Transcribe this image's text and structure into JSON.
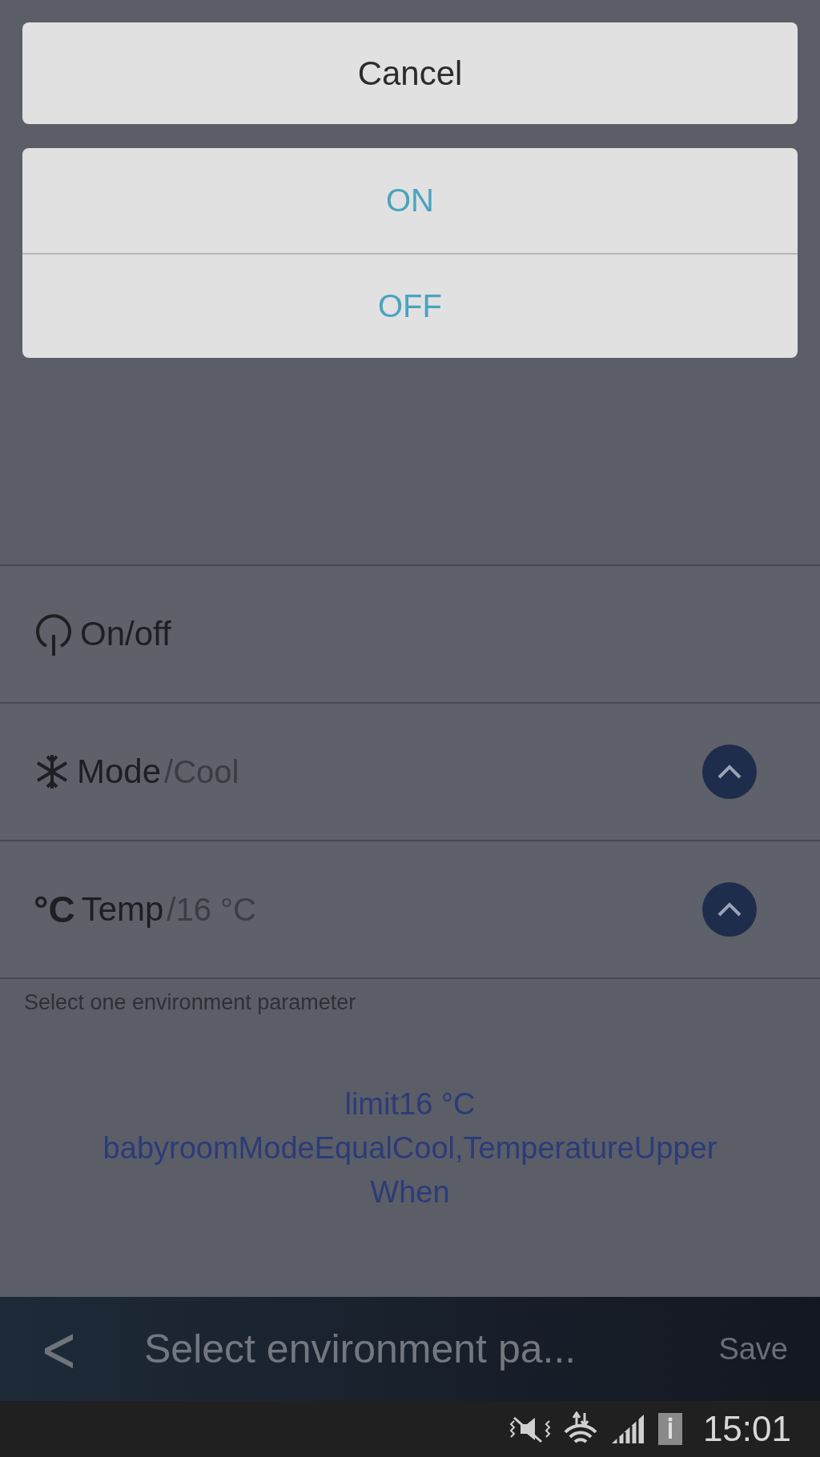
{
  "dialog": {
    "cancel": "Cancel",
    "options": [
      "ON",
      "OFF"
    ]
  },
  "parameters": [
    {
      "kind": "power",
      "label": "On/off",
      "dropdown": false
    },
    {
      "kind": "snowflake",
      "label": "Mode",
      "value": "/Cool",
      "dropdown": true
    },
    {
      "kind": "celsius",
      "icon_text": "°C",
      "label": "Temp",
      "value": "/16 °C",
      "dropdown": true
    }
  ],
  "hint": "Select one environment parameter",
  "condition": {
    "lines": [
      "limit16 °C",
      "babyroomModeEqualCool,TemperatureUpper",
      "When"
    ]
  },
  "header": {
    "back": "<",
    "title": "Select environment pa...",
    "action": "Save"
  },
  "status_bar": {
    "time": "15:01"
  }
}
